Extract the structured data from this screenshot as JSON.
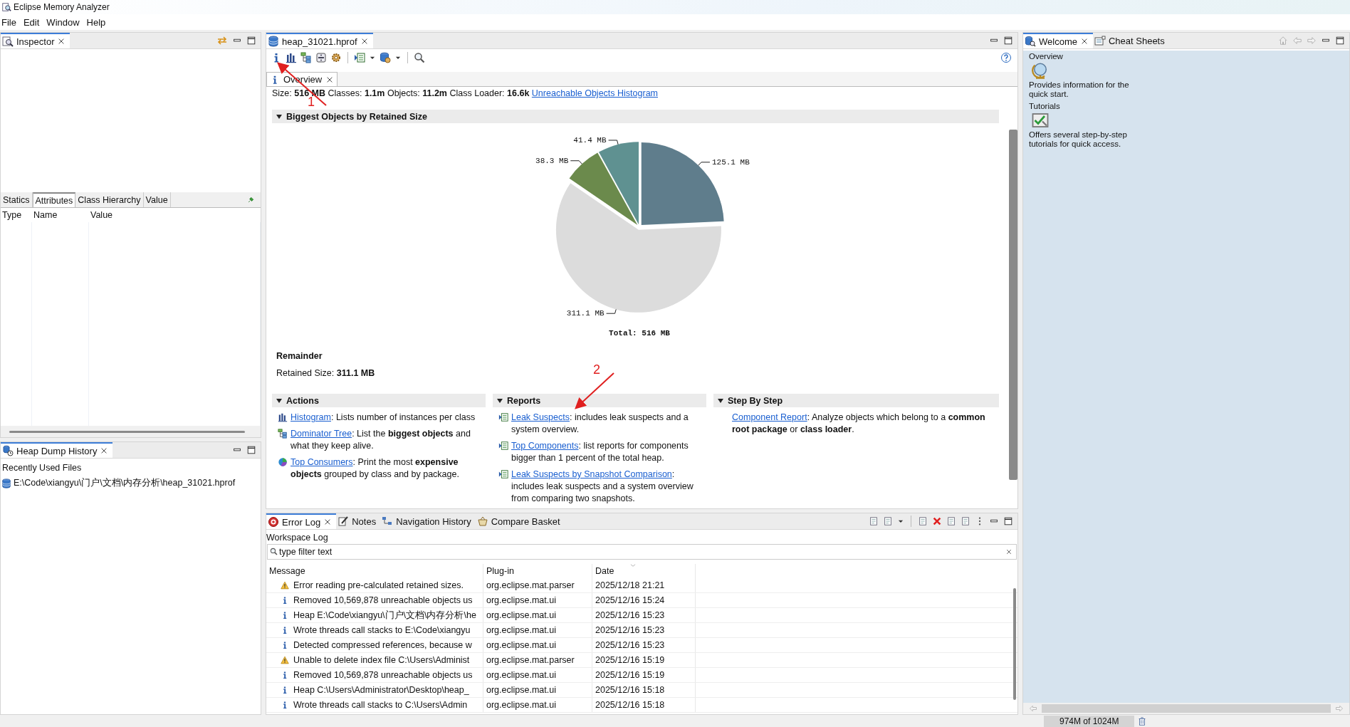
{
  "window": {
    "title": "Eclipse Memory Analyzer"
  },
  "menu": [
    "File",
    "Edit",
    "Window",
    "Help"
  ],
  "inspector": {
    "tab": "Inspector",
    "tabs": [
      {
        "label": "Statics",
        "selected": false
      },
      {
        "label": "Attributes",
        "selected": true
      },
      {
        "label": "Class Hierarchy",
        "selected": false
      },
      {
        "label": "Value",
        "selected": false
      }
    ],
    "columns": [
      "Type",
      "Name",
      "Value"
    ]
  },
  "heap_dump_history": {
    "tab": "Heap Dump History",
    "heading": "Recently Used Files",
    "files": [
      "E:\\Code\\xiangyu\\门户\\文档\\内存分析\\heap_31021.hprof"
    ]
  },
  "editor": {
    "tab": "heap_31021.hprof",
    "inner_tab": "Overview",
    "summary": "Size: **516 MB** Classes: **1.1m** Objects: **11.2m** Class Loader: **16.6k**",
    "summary_link": "Unreachable Objects Histogram",
    "biggest": {
      "heading": "Biggest Objects by Retained Size",
      "expanded": true,
      "chart_data": {
        "type": "pie",
        "values": [
          125.1,
          311.1,
          38.3,
          41.4
        ],
        "colors": [
          "#5f7d8c",
          "#dcdcdc",
          "#6b8a4c",
          "#5f9191"
        ],
        "value_labels": [
          "125.1 MB",
          "311.1 MB",
          "38.3 MB",
          "41.4 MB"
        ]
      },
      "total": "Total: 516 MB"
    },
    "remainder": {
      "title": "Remainder",
      "text": "Retained Size: **311.1 MB**"
    },
    "sections": [
      {
        "heading": "Actions",
        "expanded": true,
        "items": [
          {
            "kind": "histogram",
            "link": "Histogram",
            "text": ": Lists number of instances per class"
          },
          {
            "kind": "tree",
            "link": "Dominator Tree",
            "text": ": List the **biggest objects** and what they keep alive."
          },
          {
            "kind": "consumers",
            "link": "Top Consumers",
            "text": ": Print the most **expensive objects** grouped by class and by package."
          }
        ]
      },
      {
        "heading": "Reports",
        "expanded": true,
        "items": [
          {
            "kind": "report",
            "link": "Leak Suspects",
            "text": ": includes leak suspects and a system overview."
          },
          {
            "kind": "report",
            "link": "Top Components",
            "text": ": list reports for components bigger than 1 percent of the total heap."
          },
          {
            "kind": "report",
            "link": "Leak Suspects by Snapshot Comparison",
            "text": ": includes leak suspects and a system overview from comparing two snapshots."
          }
        ]
      },
      {
        "heading": "Step By Step",
        "expanded": true,
        "items": [
          {
            "kind": "none",
            "link": "Component Report",
            "text": ": Analyze objects which belong to a **common root package** or **class loader**."
          }
        ]
      }
    ]
  },
  "annotations": [
    {
      "label": "1"
    },
    {
      "label": "2"
    }
  ],
  "log": {
    "tabs": [
      {
        "label": "Error Log",
        "selected": true,
        "kind": "error"
      },
      {
        "label": "Notes",
        "selected": false,
        "kind": "notes"
      },
      {
        "label": "Navigation History",
        "selected": false,
        "kind": "navigation"
      },
      {
        "label": "Compare Basket",
        "selected": false,
        "kind": "compare"
      }
    ],
    "title": "Workspace Log",
    "filter": {
      "placeholder": "type filter text"
    },
    "columns": [
      "Message",
      "Plug-in",
      "Date"
    ],
    "rows": [
      {
        "kind": "warning",
        "message": "Error reading pre-calculated retained sizes.",
        "plugin": "org.eclipse.mat.parser",
        "date": "2025/12/18 21:21"
      },
      {
        "kind": "info",
        "message": "Removed 10,569,878 unreachable objects us",
        "plugin": "org.eclipse.mat.ui",
        "date": "2025/12/16 15:24"
      },
      {
        "kind": "info",
        "message": "Heap E:\\Code\\xiangyu\\门户\\文档\\内存分析\\he",
        "plugin": "org.eclipse.mat.ui",
        "date": "2025/12/16 15:23"
      },
      {
        "kind": "info",
        "message": "Wrote threads call stacks to E:\\Code\\xiangyu",
        "plugin": "org.eclipse.mat.ui",
        "date": "2025/12/16 15:23"
      },
      {
        "kind": "info",
        "message": "Detected compressed references, because w",
        "plugin": "org.eclipse.mat.ui",
        "date": "2025/12/16 15:23"
      },
      {
        "kind": "warning",
        "message": "Unable to delete index file C:\\Users\\Administ",
        "plugin": "org.eclipse.mat.parser",
        "date": "2025/12/16 15:19"
      },
      {
        "kind": "info",
        "message": "Removed 10,569,878 unreachable objects us",
        "plugin": "org.eclipse.mat.ui",
        "date": "2025/12/16 15:19"
      },
      {
        "kind": "info",
        "message": "Heap C:\\Users\\Administrator\\Desktop\\heap_",
        "plugin": "org.eclipse.mat.ui",
        "date": "2025/12/16 15:18"
      },
      {
        "kind": "info",
        "message": "Wrote threads call stacks to C:\\Users\\Admin",
        "plugin": "org.eclipse.mat.ui",
        "date": "2025/12/16 15:18"
      }
    ]
  },
  "welcome": {
    "tabs": [
      {
        "label": "Welcome",
        "selected": true,
        "kind": "welcome"
      },
      {
        "label": "Cheat Sheets",
        "selected": false,
        "kind": "cheatsheet"
      }
    ],
    "items": [
      {
        "kind": "overview",
        "title": "Overview",
        "description": "Provides information for the quick start."
      },
      {
        "kind": "tutorials",
        "title": "Tutorials",
        "description": "Offers several step-by-step tutorials for quick access."
      }
    ]
  },
  "status_bar": {
    "heap": "974M of 1024M"
  }
}
